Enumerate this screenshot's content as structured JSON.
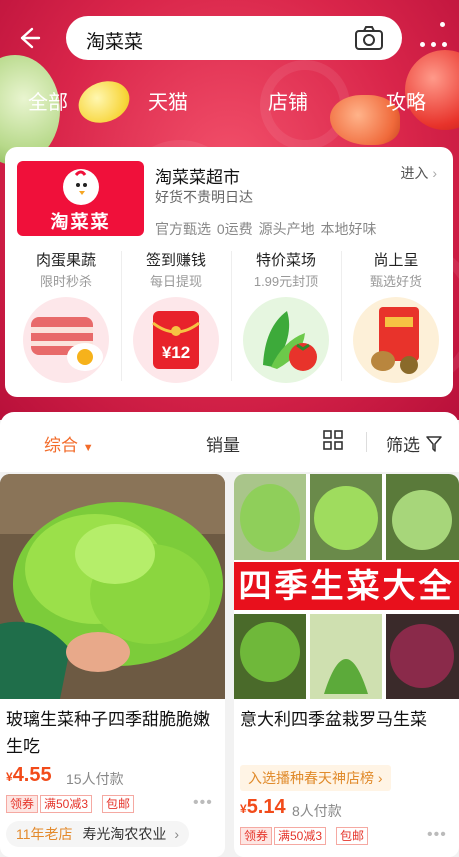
{
  "search": {
    "query": "淘菜菜"
  },
  "tabs": [
    "全部",
    "天猫",
    "店铺",
    "攻略"
  ],
  "store": {
    "logo_text": "淘菜菜",
    "title": "淘菜菜超市",
    "subtitle": "好货不贵明日达",
    "enter": "进入",
    "tags": "官方甄选 0运费 源头产地 本地好味",
    "categories": [
      {
        "title": "肉蛋果蔬",
        "sub": "限时秒杀"
      },
      {
        "title": "签到赚钱",
        "sub": "每日提现",
        "badge": "¥12"
      },
      {
        "title": "特价菜场",
        "sub": "1.99元封顶"
      },
      {
        "title": "尚上呈",
        "sub": "甄选好货"
      }
    ]
  },
  "sort": {
    "default": "综合",
    "sales": "销量",
    "filter": "筛选"
  },
  "products": [
    {
      "title": "玻璃生菜种子四季甜脆脆嫩生吃",
      "currency": "¥",
      "price": "4.55",
      "paid": "15人付款",
      "coupon": "领券",
      "discount": "满50减3",
      "shipping": "包邮",
      "shop_age": "11年老店",
      "shop_name": "寿光淘农农业"
    },
    {
      "title": "意大利四季盆栽罗马生菜",
      "banner": "四季生菜大全",
      "rank": "入选播种春天神店榜",
      "currency": "¥",
      "price": "5.14",
      "paid": "8人付款",
      "coupon": "领券",
      "discount": "满50减3",
      "shipping": "包邮"
    }
  ],
  "colors": {
    "brand_red": "#f0103a",
    "price": "#f24b1a",
    "active_sort": "#f26b2a"
  }
}
